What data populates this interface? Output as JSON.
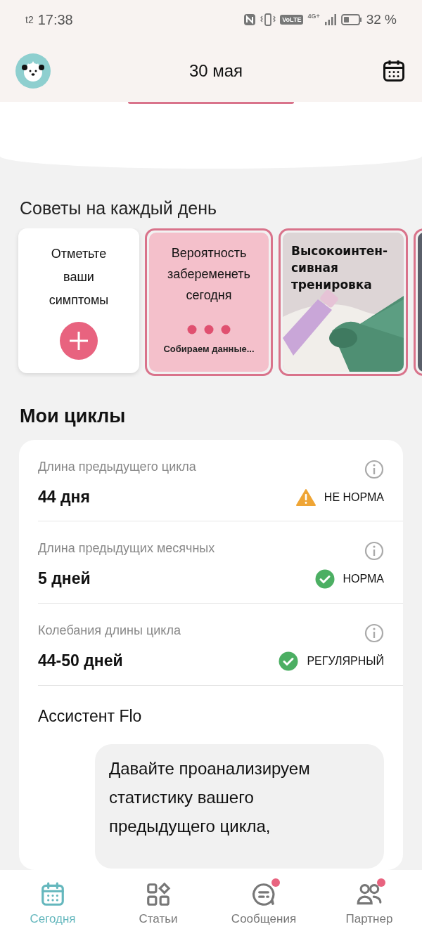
{
  "status_bar": {
    "carrier": "t2",
    "time": "17:38",
    "volte": "VoLTE",
    "network": "4G+",
    "battery": "32 %"
  },
  "header": {
    "date": "30 мая"
  },
  "tips": {
    "title": "Советы на каждый день",
    "cards": [
      {
        "kind": "action",
        "title": "Отметьте ваши симптомы"
      },
      {
        "kind": "loading",
        "title": "Вероятность забеременеть сегодня",
        "caption": "Собираем данные..."
      },
      {
        "kind": "picture",
        "title": "Высокоинтен-\nсивная тренировка"
      },
      {
        "kind": "partial"
      }
    ]
  },
  "cycles": {
    "title": "Мои циклы",
    "rows": [
      {
        "label": "Длина предыдущего цикла",
        "value": "44 дня",
        "kind": "warning",
        "status_text": "НЕ НОРМА"
      },
      {
        "label": "Длина предыдущих месячных",
        "value": "5 дней",
        "kind": "ok",
        "status_text": "НОРМА"
      },
      {
        "label": "Колебания длины цикла",
        "value": "44-50 дней",
        "kind": "ok",
        "status_text": "РЕГУЛЯРНЫЙ"
      }
    ],
    "assistant": {
      "title": "Ассистент Flo",
      "message": "Давайте проанализируем статистику вашего предыдущего цикла,"
    }
  },
  "nav": {
    "items": [
      {
        "label": "Сегодня",
        "kind": "calendar",
        "selected": true,
        "badge": false
      },
      {
        "label": "Статьи",
        "kind": "grid",
        "selected": false,
        "badge": false
      },
      {
        "label": "Сообщения",
        "kind": "chat",
        "selected": false,
        "badge": true
      },
      {
        "label": "Партнер",
        "kind": "people",
        "selected": false,
        "badge": true
      }
    ]
  }
}
